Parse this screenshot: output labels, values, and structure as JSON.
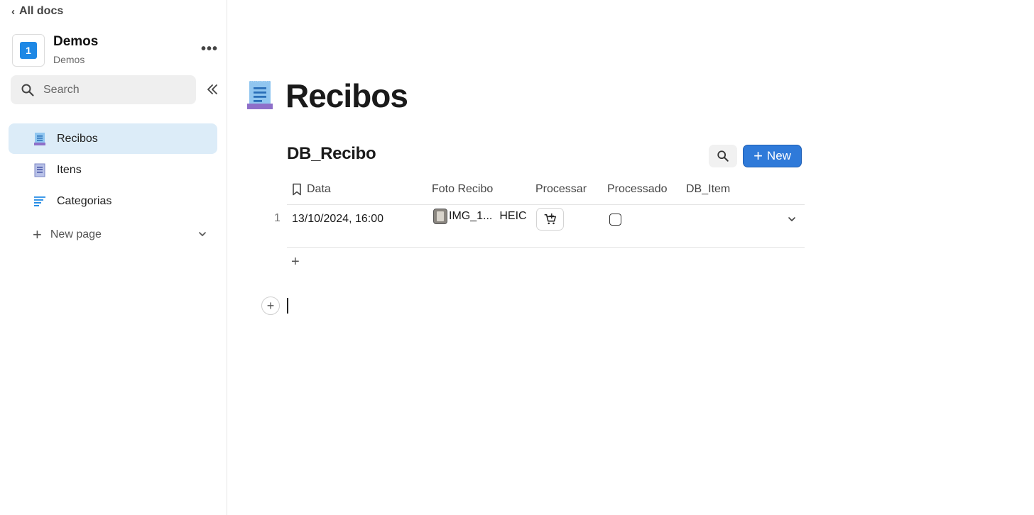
{
  "sidebar": {
    "back_label": "All docs",
    "workspace": {
      "logo_text": "1",
      "title": "Demos",
      "subtitle": "Demos",
      "more": "•••"
    },
    "search": {
      "placeholder": "Search"
    },
    "items": [
      {
        "label": "Recibos",
        "icon": "receipt-icon",
        "active": true
      },
      {
        "label": "Itens",
        "icon": "list-doc-icon",
        "active": false
      },
      {
        "label": "Categorias",
        "icon": "categories-icon",
        "active": false
      }
    ],
    "new_page_label": "New page"
  },
  "page": {
    "title": "Recibos",
    "icon": "receipt-icon"
  },
  "database": {
    "title": "DB_Recibo",
    "new_button_label": "New",
    "new_button_plus": "+",
    "columns": [
      "Data",
      "Foto Recibo",
      "Processar",
      "Processado",
      "DB_Item"
    ],
    "rows": [
      {
        "num": "1",
        "data": "13/10/2024, 16:00",
        "foto_name": "IMG_1...",
        "foto_ext": "HEIC",
        "processar_icon": "cart-add-icon",
        "processado_checked": false
      }
    ],
    "add_row_label": "+"
  },
  "editor": {
    "block_add_label": "+"
  },
  "colors": {
    "accent": "#2f7ad9",
    "active_nav": "#dcecf8",
    "search_bg": "#efefef"
  }
}
